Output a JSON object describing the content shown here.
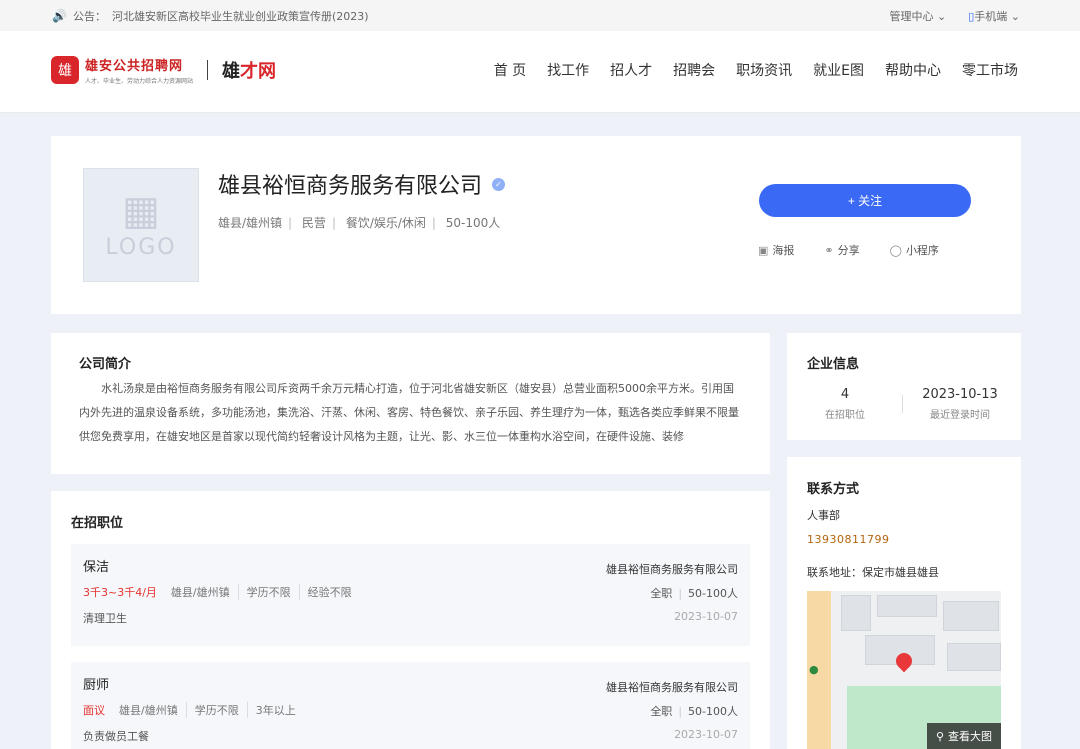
{
  "topbar": {
    "notice_label": "公告：",
    "notice_text": "河北雄安新区高校毕业生就业创业政策宣传册(2023)",
    "manage_center": "管理中心",
    "mobile": "手机端"
  },
  "header": {
    "logo_badge": "雄",
    "logo_title": "雄安公共招聘网",
    "logo_sub": "人才、毕业生、劳动力综合人力资源网站",
    "brand_left": "雄",
    "brand_right": "才网",
    "nav": [
      "首 页",
      "找工作",
      "招人才",
      "招聘会",
      "职场资讯",
      "就业E图",
      "帮助中心",
      "零工市场"
    ]
  },
  "company": {
    "logo_placeholder": "LOGO",
    "name": "雄县裕恒商务服务有限公司",
    "location": "雄县/雄州镇",
    "ownership": "民营",
    "industry": "餐饮/娱乐/休闲",
    "size": "50-100人",
    "follow_label": "+ 关注",
    "actions": {
      "poster": "海报",
      "share": "分享",
      "mini_program": "小程序"
    }
  },
  "intro": {
    "title": "公司简介",
    "text": "水礼汤泉是由裕恒商务服务有限公司斥资两千余万元精心打造，位于河北省雄安新区（雄安县）总营业面积5000余平方米。引用国内外先进的温泉设备系统，多功能汤池，集洗浴、汗蒸、休闲、客房、特色餐饮、亲子乐园、养生理疗为一体，甄选各类应季鲜果不限量供您免费享用，在雄安地区是首家以现代简约轻奢设计风格为主题，让光、影、水三位一体重构水浴空间，在硬件设施、装修"
  },
  "jobs": {
    "title": "在招职位",
    "items": [
      {
        "title": "保洁",
        "salary": "3千3~3千4/月",
        "location": "雄县/雄州镇",
        "education": "学历不限",
        "experience": "经验不限",
        "desc": "清理卫生",
        "company": "雄县裕恒商务服务有限公司",
        "type": "全职",
        "size": "50-100人",
        "date": "2023-10-07"
      },
      {
        "title": "厨师",
        "salary": "面议",
        "location": "雄县/雄州镇",
        "education": "学历不限",
        "experience": "3年以上",
        "desc": "负责做员工餐",
        "company": "雄县裕恒商务服务有限公司",
        "type": "全职",
        "size": "50-100人",
        "date": "2023-10-07"
      }
    ]
  },
  "info": {
    "title": "企业信息",
    "jobs_count": "4",
    "jobs_label": "在招职位",
    "last_login": "2023-10-13",
    "last_login_label": "最近登录时间"
  },
  "contact": {
    "title": "联系方式",
    "dept": "人事部",
    "phone": "13930811799",
    "address": "联系地址：保定市雄县雄县",
    "map_button": "查看大图"
  },
  "colors": {
    "accent": "#3a6af5",
    "salary": "#e5322d",
    "brand_red": "#d8262b",
    "phone": "#b5650f"
  }
}
